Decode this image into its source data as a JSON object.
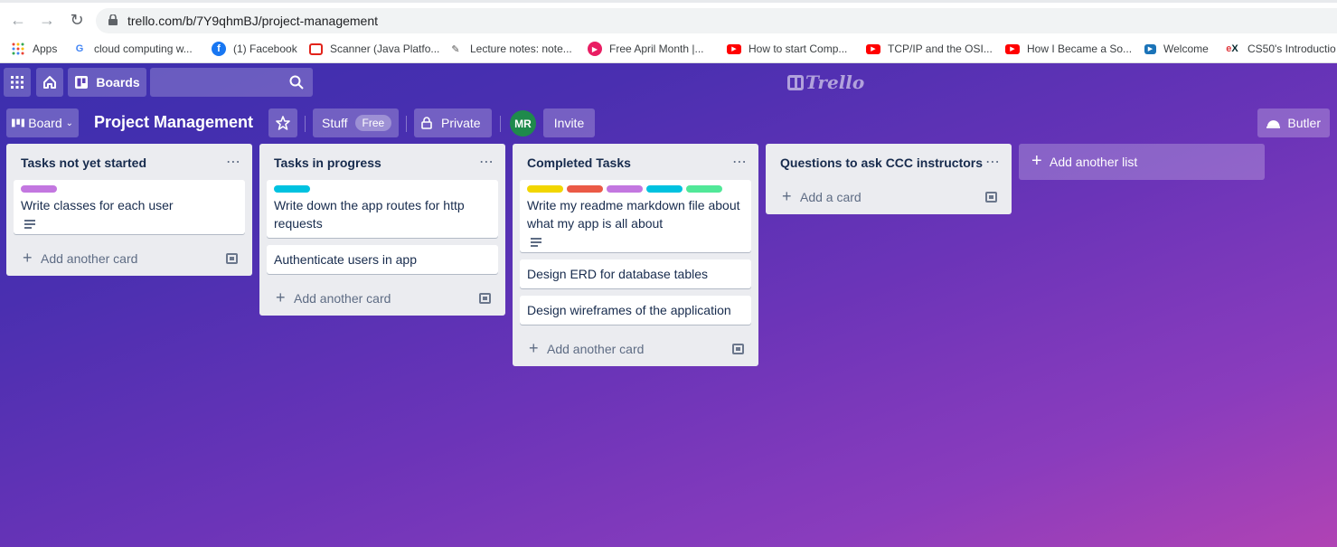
{
  "browser": {
    "url": "trello.com/b/7Y9qhmBJ/project-management",
    "bookmarks": [
      {
        "label": "Apps",
        "icon": "apps-grid-icon"
      },
      {
        "label": "cloud computing w...",
        "icon": "google-icon"
      },
      {
        "label": "(1) Facebook",
        "icon": "facebook-icon"
      },
      {
        "label": "Scanner (Java Platfo...",
        "icon": "oracle-icon"
      },
      {
        "label": "Lecture notes: note...",
        "icon": "notes-icon"
      },
      {
        "label": "Free April Month |...",
        "icon": "play-icon"
      },
      {
        "label": "How to start Comp...",
        "icon": "youtube-icon"
      },
      {
        "label": "TCP/IP and the OSI...",
        "icon": "youtube-icon"
      },
      {
        "label": "How I Became a So...",
        "icon": "youtube-icon"
      },
      {
        "label": "Welcome",
        "icon": "video-icon"
      },
      {
        "label": "CS50's Introductio",
        "icon": "edx-icon"
      }
    ]
  },
  "topbar": {
    "boards_label": "Boards",
    "logo_text": "Trello"
  },
  "board": {
    "view_label": "Board",
    "title": "Project Management",
    "team_label": "Stuff",
    "team_badge": "Free",
    "visibility_label": "Private",
    "avatar_initials": "MR",
    "invite_label": "Invite",
    "butler_label": "Butler"
  },
  "lists": [
    {
      "title": "Tasks not yet started",
      "cards": [
        {
          "text": "Write classes for each user",
          "labels": [
            "#c377e0"
          ],
          "has_description": true
        }
      ],
      "add_label": "Add another card"
    },
    {
      "title": "Tasks in progress",
      "cards": [
        {
          "text": "Write down the app routes for http requests",
          "labels": [
            "#00c2e0"
          ],
          "has_description": false
        },
        {
          "text": "Authenticate users in app",
          "labels": [],
          "has_description": false
        }
      ],
      "add_label": "Add another card"
    },
    {
      "title": "Completed Tasks",
      "cards": [
        {
          "text": "Write my readme markdown file about what my app is all about",
          "labels": [
            "#f2d600",
            "#eb5a46",
            "#c377e0",
            "#00c2e0",
            "#51e898"
          ],
          "has_description": true
        },
        {
          "text": "Design ERD for database tables",
          "labels": [],
          "has_description": false
        },
        {
          "text": "Design wireframes of the application",
          "labels": [],
          "has_description": false
        }
      ],
      "add_label": "Add another card"
    },
    {
      "title": "Questions to ask CCC instructors",
      "cards": [],
      "add_label": "Add a card"
    }
  ],
  "add_list_label": "Add another list"
}
